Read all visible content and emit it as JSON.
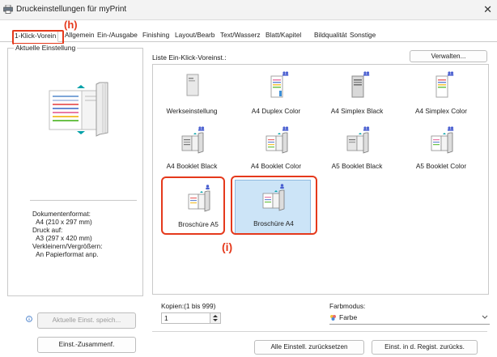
{
  "window": {
    "title": "Druckeinstellungen für myPrint",
    "close_glyph": "✕"
  },
  "tabs": [
    {
      "label": "1-Klick-Vorein",
      "active": true
    },
    {
      "label": "Allgemein",
      "active": false
    },
    {
      "label": "Ein-/Ausgabe",
      "active": false
    },
    {
      "label": "Finishing",
      "active": false
    },
    {
      "label": "Layout/Bearb",
      "active": false
    },
    {
      "label": "Text/Wasserz",
      "active": false
    },
    {
      "label": "Blatt/Kapitel",
      "active": false
    },
    {
      "label": "Bildqualität",
      "active": false
    },
    {
      "label": "Sonstige",
      "active": false
    }
  ],
  "callouts": {
    "h": "(h)",
    "i": "(i)",
    "color": "#e5391c"
  },
  "current_setting": {
    "group_title": "Aktuelle Einstellung",
    "info_lines": [
      "Dokumentenformat:",
      "  A4 (210 x 297 mm)",
      "Druck auf:",
      "  A3 (297 x 420 mm)",
      "Verkleinern/Vergrößern:",
      "  An Papierformat anp."
    ],
    "info_icon": "info-icon",
    "save_button": "Aktuelle Einst. speich...",
    "summary_button": "Einst.-Zusammenf."
  },
  "presets": {
    "list_label": "Liste Ein-Klick-Voreinst.:",
    "manage_button": "Verwalten...",
    "items": [
      {
        "label": "Werkseinstellung",
        "icon": "single-page-icon",
        "badge": "none",
        "selected": false
      },
      {
        "label": "A4 Duplex Color",
        "icon": "duplex-page-icon",
        "badge": "group",
        "selected": false
      },
      {
        "label": "A4 Simplex Black",
        "icon": "single-page-icon",
        "badge": "group",
        "selected": false
      },
      {
        "label": "A4 Simplex Color",
        "icon": "single-page-icon",
        "badge": "group",
        "selected": false
      },
      {
        "label": "A4 Booklet Black",
        "icon": "booklet-icon",
        "badge": "group",
        "selected": false
      },
      {
        "label": "A4 Booklet Color",
        "icon": "booklet-icon",
        "badge": "group",
        "selected": false
      },
      {
        "label": "A5 Booklet Black",
        "icon": "booklet-icon",
        "badge": "group",
        "selected": false
      },
      {
        "label": "A5 Booklet Color",
        "icon": "booklet-icon",
        "badge": "group",
        "selected": false
      },
      {
        "label": "Broschüre A5",
        "icon": "booklet-icon",
        "badge": "user",
        "selected": false
      },
      {
        "label": "Broschüre A4",
        "icon": "booklet-icon",
        "badge": "user",
        "selected": true
      }
    ]
  },
  "copies": {
    "label": "Kopien:(1 bis 999)",
    "value": "1"
  },
  "color_mode": {
    "label": "Farbmodus:",
    "value": "Farbe"
  },
  "footer": {
    "reset_all": "Alle Einstell. zurücksetzen",
    "reset_registry": "Einst. in d. Regist. zurücks."
  },
  "colors": {
    "accent": "#0078d4",
    "selection": "#cce4f7",
    "callout": "#e5391c"
  }
}
